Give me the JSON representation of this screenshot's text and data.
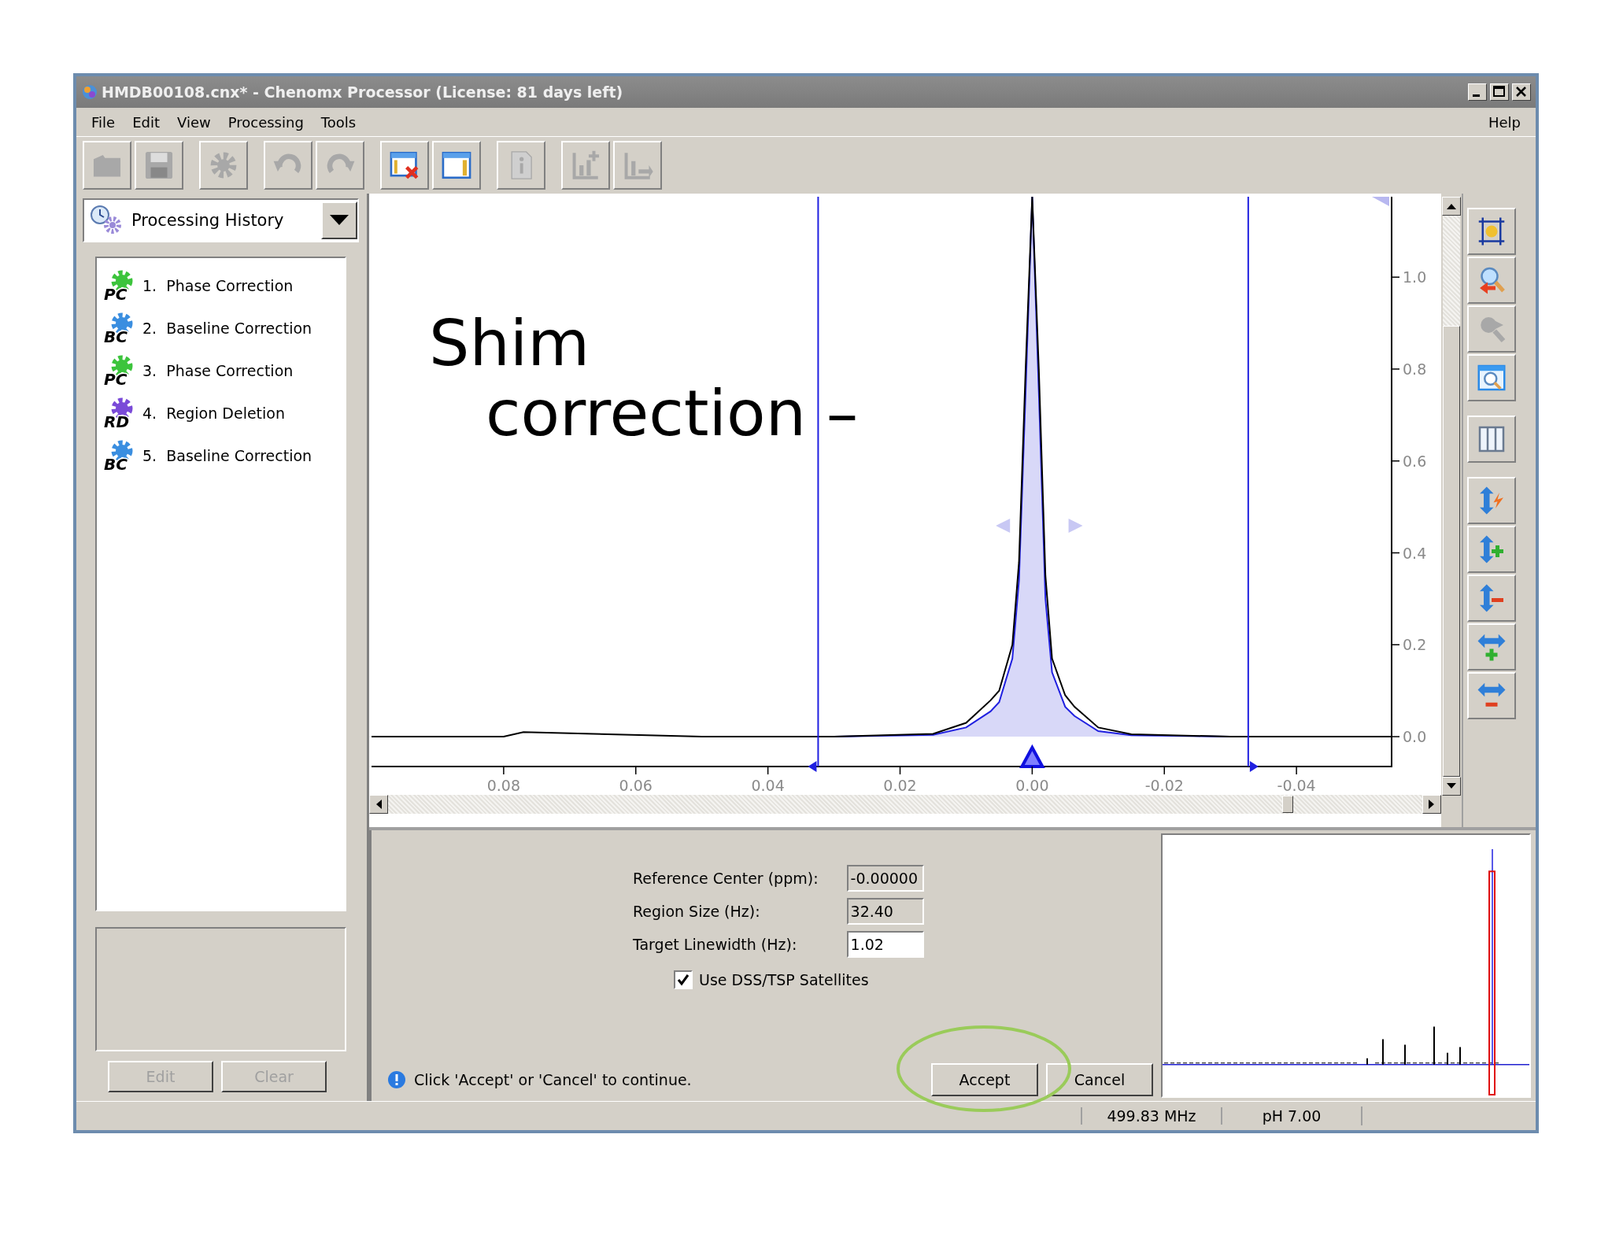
{
  "window": {
    "title": "HMDB00108.cnx* - Chenomx Processor (License: 81 days left)"
  },
  "menu": {
    "items": [
      "File",
      "Edit",
      "View",
      "Processing",
      "Tools"
    ],
    "help": "Help"
  },
  "toolbar": [
    {
      "kind": "open",
      "disabled": true
    },
    {
      "kind": "save",
      "disabled": true
    },
    {
      "kind": "gear",
      "disabled": true
    },
    {
      "kind": "undo",
      "disabled": true
    },
    {
      "kind": "redo",
      "disabled": true
    },
    {
      "kind": "panel-remove",
      "disabled": false
    },
    {
      "kind": "panel",
      "disabled": false
    },
    {
      "kind": "info",
      "disabled": true
    },
    {
      "kind": "chart-add",
      "disabled": true
    },
    {
      "kind": "chart-export",
      "disabled": true
    }
  ],
  "history": {
    "title": "Processing History",
    "items": [
      {
        "number": "1.",
        "label": "Phase Correction",
        "badge": "PC",
        "color": "#3cc43c"
      },
      {
        "number": "2.",
        "label": "Baseline Correction",
        "badge": "BC",
        "color": "#3a8ee0"
      },
      {
        "number": "3.",
        "label": "Phase Correction",
        "badge": "PC",
        "color": "#3cc43c"
      },
      {
        "number": "4.",
        "label": "Region Deletion",
        "badge": "RD",
        "color": "#7a4ad8"
      },
      {
        "number": "5.",
        "label": "Baseline Correction",
        "badge": "BC",
        "color": "#3a8ee0"
      }
    ],
    "buttons": [
      {
        "label": "Edit",
        "disabled": true
      },
      {
        "label": "Clear",
        "disabled": true
      }
    ]
  },
  "spectrum": {
    "chart_data": {
      "type": "line",
      "xlim": [
        0.1,
        -0.0544
      ],
      "ylim": [
        -0.065,
        1.175
      ],
      "xticks": [
        {
          "value": 0.08,
          "label": "0.08"
        },
        {
          "value": 0.06,
          "label": "0.06"
        },
        {
          "value": 0.04,
          "label": "0.04"
        },
        {
          "value": 0.02,
          "label": "0.02"
        },
        {
          "value": 0,
          "label": "0.00"
        },
        {
          "value": -0.02,
          "label": "-0.02"
        },
        {
          "value": -0.04,
          "label": "-0.04"
        }
      ],
      "yticks": [
        {
          "value": 0,
          "label": "0.0"
        },
        {
          "value": 0.2,
          "label": "0.2"
        },
        {
          "value": 0.4,
          "label": "0.4"
        },
        {
          "value": 0.6,
          "label": "0.6"
        },
        {
          "value": 0.8,
          "label": "0.8"
        },
        {
          "value": 1.0,
          "label": "1.0"
        }
      ],
      "x": [
        0.1,
        0.08,
        0.077,
        0.05,
        0.03,
        0.015,
        0.01,
        0.0063,
        0.005,
        0.003,
        0.002,
        0.001,
        0.0,
        -0.001,
        -0.002,
        -0.003,
        -0.005,
        -0.0064,
        -0.01,
        -0.015,
        -0.03,
        -0.0544
      ],
      "series": [
        {
          "color": "#000000",
          "values": [
            0.0,
            0.0,
            0.01,
            0.0,
            0.0,
            0.006,
            0.03,
            0.079,
            0.1,
            0.2,
            0.38,
            0.8,
            1.175,
            0.8,
            0.35,
            0.17,
            0.09,
            0.065,
            0.02,
            0.005,
            0.0,
            0.0
          ]
        },
        {
          "color": "#2020e0",
          "values": [
            null,
            null,
            null,
            null,
            0.0,
            0.004,
            0.02,
            0.055,
            0.075,
            0.17,
            0.34,
            0.75,
            1.175,
            0.75,
            0.3,
            0.14,
            0.065,
            0.045,
            0.012,
            0.003,
            0.0,
            null
          ]
        }
      ],
      "ref_lines": [
        {
          "axis": "x",
          "value": 0.0324,
          "color": "#2020e0"
        },
        {
          "axis": "x",
          "value": -0.0327,
          "color": "#2020e0"
        }
      ]
    }
  },
  "form": {
    "fields": [
      {
        "label": "Reference Center (ppm):",
        "value": "-0.00000",
        "disabled": true
      },
      {
        "label": "Region Size (Hz):",
        "value": "32.40",
        "disabled": true
      },
      {
        "label": "Target Linewidth (Hz):",
        "value": "1.02",
        "disabled": false
      }
    ],
    "checkbox": {
      "label": "Use DSS/TSP Satellites",
      "checked": true
    },
    "message": "Click 'Accept' or 'Cancel' to continue.",
    "buttons": [
      "Accept",
      "Cancel"
    ]
  },
  "status_bar": [
    "499.83 MHz",
    "pH 7.00"
  ],
  "overlay_caption": {
    "lines": [
      "Shim",
      "correction –"
    ]
  }
}
